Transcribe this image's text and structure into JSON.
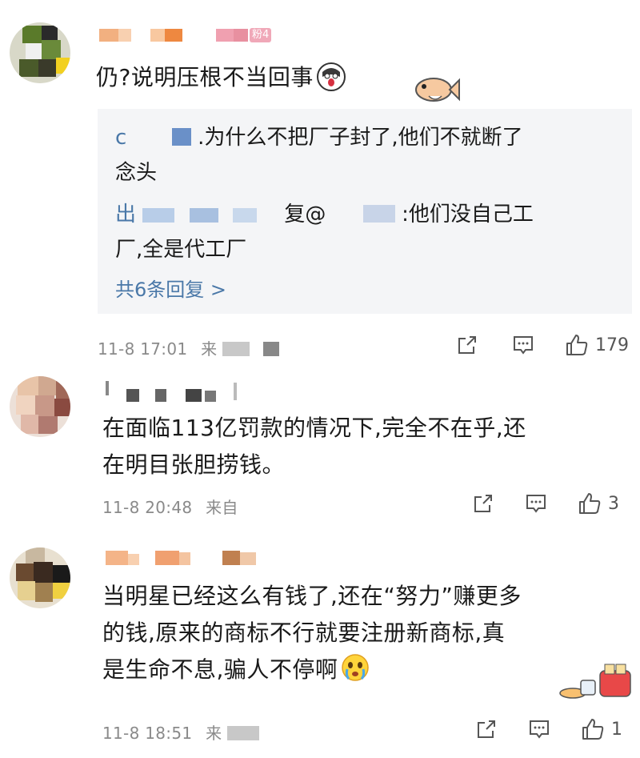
{
  "comments": [
    {
      "badge": "粉4",
      "text": "仍?说明压根不当回事",
      "emoji": "shock-face",
      "sticker": "fish",
      "replies": {
        "reply1_prefix": "c",
        "reply1_text": ".为什么不把厂子封了,他们不就断了",
        "reply1_cont": "念头",
        "reply2_prefix": "出",
        "reply2_mid": "复@",
        "reply2_text": ":他们没自己工",
        "reply2_cont": "厂,全是代工厂",
        "more": "共6条回复 >"
      },
      "time": "11-8 17:01",
      "source": "来",
      "likes": "179"
    },
    {
      "text_line1": "在面临113亿罚款的情况下,完全不在乎,还",
      "text_line2": "在明目张胆捞钱。",
      "time": "11-8 20:48",
      "source": "来自",
      "likes": "3"
    },
    {
      "text_line1": "当明星已经这么有钱了,还在“努力”赚更多",
      "text_line2": "的钱,原来的商标不行就要注册新商标,真",
      "text_line3": "是生命不息,骗人不停啊",
      "emoji": "crying-face",
      "sticker": "breakfast",
      "time": "11-8 18:51",
      "source": "来",
      "likes": "1"
    }
  ],
  "colors": {
    "link": "#4a78a8",
    "meta": "#8a8a8a",
    "reply_bg": "#f4f5f7"
  }
}
